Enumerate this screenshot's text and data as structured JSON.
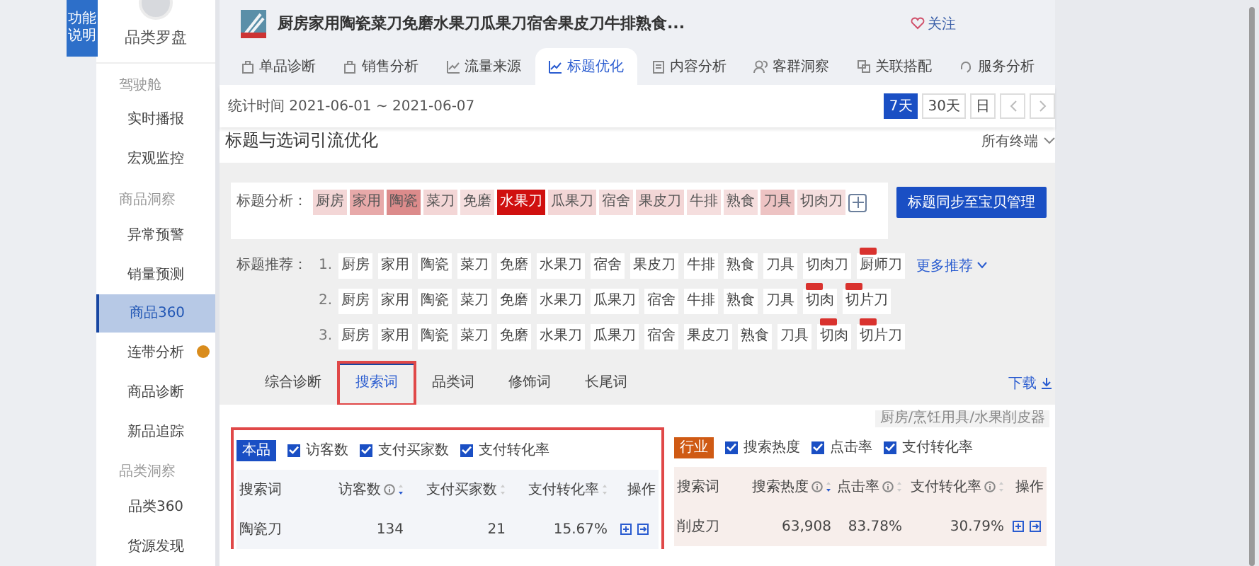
{
  "help_tab": {
    "label": "功能说明"
  },
  "sidebar": {
    "title": "品类罗盘",
    "groups": [
      {
        "label": "驾驶舱",
        "items": [
          {
            "label": "实时播报",
            "selected": false,
            "dot": false
          },
          {
            "label": "宏观监控",
            "selected": false,
            "dot": false
          }
        ]
      },
      {
        "label": "商品洞察",
        "items": [
          {
            "label": "异常预警",
            "selected": false,
            "dot": false
          },
          {
            "label": "销量预测",
            "selected": false,
            "dot": false
          },
          {
            "label": "商品360",
            "selected": true,
            "dot": false
          },
          {
            "label": "连带分析",
            "selected": false,
            "dot": true
          },
          {
            "label": "商品诊断",
            "selected": false,
            "dot": false
          },
          {
            "label": "新品追踪",
            "selected": false,
            "dot": false
          }
        ]
      },
      {
        "label": "品类洞察",
        "items": [
          {
            "label": "品类360",
            "selected": false,
            "dot": false
          },
          {
            "label": "货源发现",
            "selected": false,
            "dot": false
          }
        ]
      }
    ]
  },
  "product": {
    "title": "厨房家用陶瓷菜刀免磨水果刀瓜果刀宿舍果皮刀牛排熟食...",
    "follow": "关注"
  },
  "tabs": [
    {
      "label": "单品诊断",
      "selected": false
    },
    {
      "label": "销售分析",
      "selected": false
    },
    {
      "label": "流量来源",
      "selected": false
    },
    {
      "label": "标题优化",
      "selected": true
    },
    {
      "label": "内容分析",
      "selected": false
    },
    {
      "label": "客群洞察",
      "selected": false
    },
    {
      "label": "关联搭配",
      "selected": false
    },
    {
      "label": "服务分析",
      "selected": false
    }
  ],
  "date_bar": {
    "label": "统计时间 2021-06-01 ~ 2021-06-07",
    "ranges": [
      {
        "label": "7天",
        "selected": true
      },
      {
        "label": "30天",
        "selected": false
      },
      {
        "label": "日",
        "selected": false
      }
    ]
  },
  "section": {
    "title": "标题与选词引流优化",
    "terminal": "所有终端"
  },
  "title_analysis": {
    "label": "标题分析：",
    "tokens": [
      {
        "text": "厨房",
        "color": "#f3d6d6"
      },
      {
        "text": "家用",
        "color": "#e7a9a9"
      },
      {
        "text": "陶瓷",
        "color": "#dc8b8b"
      },
      {
        "text": "菜刀",
        "color": "#f3d6d6"
      },
      {
        "text": "免磨",
        "color": "#f5dede"
      },
      {
        "text": "水果刀",
        "color": "#d0100f"
      },
      {
        "text": "瓜果刀",
        "color": "#f3d6d6"
      },
      {
        "text": "宿舍",
        "color": "#f5dede"
      },
      {
        "text": "果皮刀",
        "color": "#f3d6d6"
      },
      {
        "text": "牛排",
        "color": "#f5dede"
      },
      {
        "text": "熟食",
        "color": "#f5dede"
      },
      {
        "text": "刀具",
        "color": "#edc3c3"
      },
      {
        "text": "切肉刀",
        "color": "#f5dede"
      }
    ],
    "sync_button": "标题同步至宝贝管理"
  },
  "recommendations": {
    "label": "标题推荐：",
    "more": "更多推荐",
    "rows": [
      {
        "index": "1.",
        "tokens": [
          {
            "text": "厨房",
            "new": false
          },
          {
            "text": "家用",
            "new": false
          },
          {
            "text": "陶瓷",
            "new": false
          },
          {
            "text": "菜刀",
            "new": false
          },
          {
            "text": "免磨",
            "new": false
          },
          {
            "text": "水果刀",
            "new": false
          },
          {
            "text": "宿舍",
            "new": false
          },
          {
            "text": "果皮刀",
            "new": false
          },
          {
            "text": "牛排",
            "new": false
          },
          {
            "text": "熟食",
            "new": false
          },
          {
            "text": "刀具",
            "new": false
          },
          {
            "text": "切肉刀",
            "new": false
          },
          {
            "text": "厨师刀",
            "new": true
          }
        ]
      },
      {
        "index": "2.",
        "tokens": [
          {
            "text": "厨房",
            "new": false
          },
          {
            "text": "家用",
            "new": false
          },
          {
            "text": "陶瓷",
            "new": false
          },
          {
            "text": "菜刀",
            "new": false
          },
          {
            "text": "免磨",
            "new": false
          },
          {
            "text": "水果刀",
            "new": false
          },
          {
            "text": "瓜果刀",
            "new": false
          },
          {
            "text": "宿舍",
            "new": false
          },
          {
            "text": "牛排",
            "new": false
          },
          {
            "text": "熟食",
            "new": false
          },
          {
            "text": "刀具",
            "new": false
          },
          {
            "text": "切肉",
            "new": true
          },
          {
            "text": "切片刀",
            "new": true
          }
        ]
      },
      {
        "index": "3.",
        "tokens": [
          {
            "text": "厨房",
            "new": false
          },
          {
            "text": "家用",
            "new": false
          },
          {
            "text": "陶瓷",
            "new": false
          },
          {
            "text": "菜刀",
            "new": false
          },
          {
            "text": "免磨",
            "new": false
          },
          {
            "text": "水果刀",
            "new": false
          },
          {
            "text": "瓜果刀",
            "new": false
          },
          {
            "text": "宿舍",
            "new": false
          },
          {
            "text": "果皮刀",
            "new": false
          },
          {
            "text": "熟食",
            "new": false
          },
          {
            "text": "刀具",
            "new": false
          },
          {
            "text": "切肉",
            "new": true
          },
          {
            "text": "切片刀",
            "new": true
          }
        ]
      }
    ]
  },
  "word_tabs": [
    {
      "label": "综合诊断",
      "selected": false,
      "highlighted": false
    },
    {
      "label": "搜索词",
      "selected": true,
      "highlighted": true
    },
    {
      "label": "品类词",
      "selected": false,
      "highlighted": false
    },
    {
      "label": "修饰词",
      "selected": false,
      "highlighted": false
    },
    {
      "label": "长尾词",
      "selected": false,
      "highlighted": false
    }
  ],
  "download": "下载",
  "category_path": "厨房/烹饪用具/水果削皮器",
  "panels": [
    {
      "kind": "own",
      "badge": "本品",
      "highlighted": true,
      "metrics": [
        {
          "label": "访客数",
          "checked": true
        },
        {
          "label": "支付买家数",
          "checked": true
        },
        {
          "label": "支付转化率",
          "checked": true
        }
      ],
      "columns": [
        {
          "label": "搜索词",
          "info": false,
          "sortable": false
        },
        {
          "label": "访客数",
          "info": true,
          "sortable": true,
          "sorted": true
        },
        {
          "label": "支付买家数",
          "info": false,
          "sortable": true,
          "sorted": false
        },
        {
          "label": "支付转化率",
          "info": false,
          "sortable": true,
          "sorted": false
        },
        {
          "label": "操作",
          "info": false,
          "sortable": false
        }
      ],
      "rows": [
        [
          "陶瓷刀",
          "134",
          "21",
          "15.67%"
        ]
      ]
    },
    {
      "kind": "industry",
      "badge": "行业",
      "highlighted": false,
      "metrics": [
        {
          "label": "搜索热度",
          "checked": true
        },
        {
          "label": "点击率",
          "checked": true
        },
        {
          "label": "支付转化率",
          "checked": true
        }
      ],
      "columns": [
        {
          "label": "搜索词",
          "info": false,
          "sortable": false
        },
        {
          "label": "搜索热度",
          "info": true,
          "sortable": true,
          "sorted": true
        },
        {
          "label": "点击率",
          "info": true,
          "sortable": true,
          "sorted": false
        },
        {
          "label": "支付转化率",
          "info": true,
          "sortable": true,
          "sorted": false
        },
        {
          "label": "操作",
          "info": false,
          "sortable": false
        }
      ],
      "rows": [
        [
          "削皮刀",
          "63,908",
          "83.78%",
          "30.79%"
        ]
      ]
    }
  ]
}
